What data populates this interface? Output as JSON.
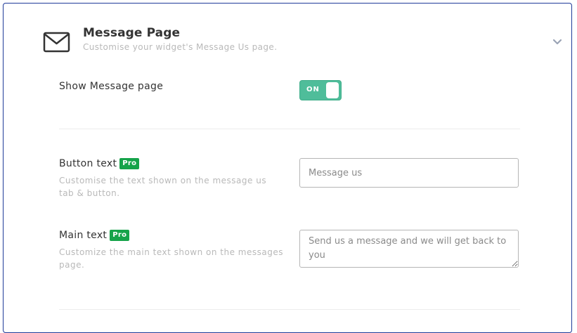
{
  "section": {
    "title": "Message Page",
    "subtitle": "Customise your widget's Message Us page.",
    "icon": "envelope-icon",
    "collapse_icon": "chevron-down-icon"
  },
  "show_message_page": {
    "label": "Show Message page",
    "toggle_label": "ON",
    "toggle_state": true,
    "toggle_color": "#4fbd9a"
  },
  "button_text": {
    "label": "Button text",
    "badge": "Pro",
    "help": "Customise the text shown on the message us tab & button.",
    "placeholder": "Message us",
    "value": ""
  },
  "main_text": {
    "label": "Main text",
    "badge": "Pro",
    "help": "Customize the main text shown on the messages page.",
    "placeholder": "Send us a message and we will get back to you",
    "value": ""
  },
  "colors": {
    "border_accent": "#1f3b99",
    "pro_badge": "#16a34a"
  }
}
